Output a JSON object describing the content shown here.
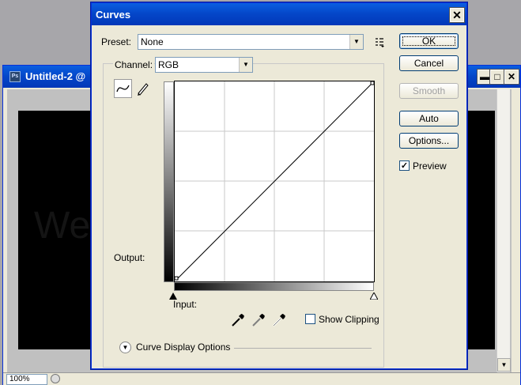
{
  "document_window": {
    "title": "Untitled-2 @",
    "icon_text": "Ps",
    "canvas_text": "We",
    "zoom": "100%",
    "buttons": {
      "minimize": "▬",
      "maximize": "□",
      "close": "✕"
    }
  },
  "curves_dialog": {
    "title": "Curves",
    "close_glyph": "✕",
    "preset": {
      "label": "Preset:",
      "value": "None"
    },
    "channel": {
      "label": "Channel:",
      "value": "RGB"
    },
    "output_label": "Output:",
    "input_label": "Input:",
    "show_clipping": {
      "label": "Show Clipping",
      "checked": false
    },
    "curve_display_options": "Curve Display Options",
    "buttons": {
      "ok": "OK",
      "cancel": "Cancel",
      "smooth": "Smooth",
      "auto": "Auto",
      "options": "Options..."
    },
    "preview": {
      "label": "Preview",
      "checked": true,
      "check_glyph": "✓"
    }
  },
  "icons": [
    "photoshop-doc-icon",
    "preset-menu-icon",
    "curve-tool-icon",
    "pencil-tool-icon",
    "black-point-eyedropper-icon",
    "gray-point-eyedropper-icon",
    "white-point-eyedropper-icon",
    "chevron-down-icon"
  ],
  "colors": {
    "titlebar": "#0446c8",
    "dialog_bg": "#ece9d8",
    "text": "#000000",
    "disabled_text": "#a0a0a0"
  }
}
